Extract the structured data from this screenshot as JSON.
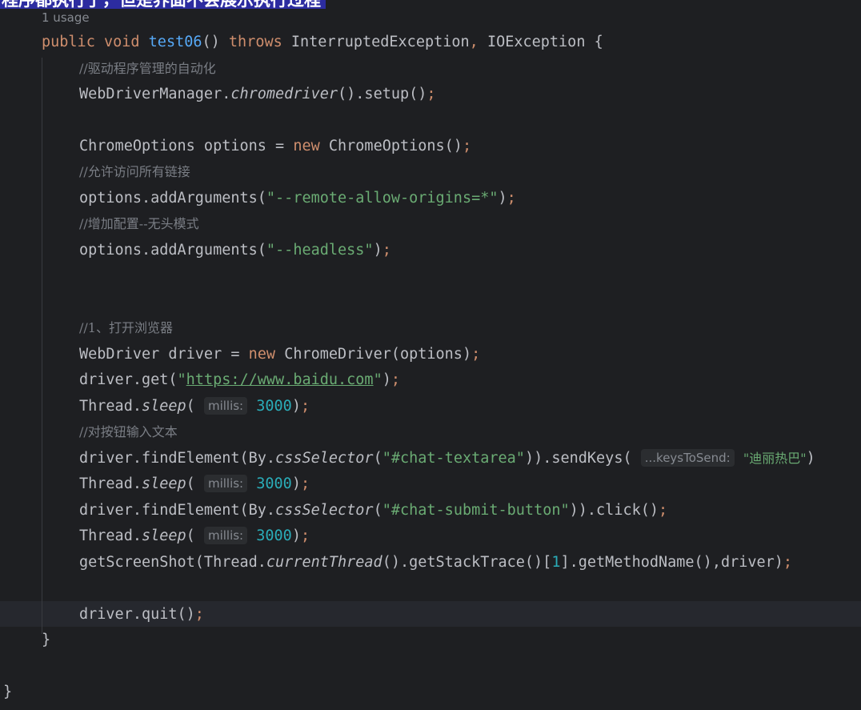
{
  "caption": "程序都执行了，但是界面不会展示执行过程",
  "usage_hint": "1 usage",
  "colors": {
    "background": "#1e1f22",
    "keyword": "#cf8e6d",
    "method": "#56a8f5",
    "string": "#6aab73",
    "number": "#2aacb8",
    "comment": "#7a7e85",
    "text": "#bcbec4"
  },
  "code": {
    "l1": {
      "public": "public",
      "void": "void",
      "name": "test06",
      "paren": "()",
      "throws": "throws",
      "ex1": "InterruptedException",
      "comma": ",",
      "ex2": "IOException {"
    },
    "l2": {
      "comment": "//驱动程序管理的自动化"
    },
    "l3": {
      "a": "WebDriverManager.",
      "b": "chromedriver",
      "c": "().setup()",
      "semi": ";"
    },
    "l4": {
      "a": "ChromeOptions options = ",
      "new": "new",
      "b": "ChromeOptions()",
      "semi": ";"
    },
    "l5": {
      "comment": "//允许访问所有链接"
    },
    "l6": {
      "a": "options.addArguments(",
      "s": "\"--remote-allow-origins=*\"",
      "b": ")",
      "semi": ";"
    },
    "l7": {
      "comment": "//增加配置--无头模式"
    },
    "l8": {
      "a": "options.addArguments(",
      "s": "\"--headless\"",
      "b": ")",
      "semi": ";"
    },
    "l9": {
      "comment": "//1、打开浏览器"
    },
    "l10": {
      "a": "WebDriver driver = ",
      "new": "new",
      "b": "ChromeDriver(options)",
      "semi": ";"
    },
    "l11": {
      "a": "driver.get(",
      "q1": "\"",
      "url": "https://www.baidu.com",
      "q2": "\"",
      "b": ")",
      "semi": ";"
    },
    "l12": {
      "a": "Thread.",
      "m": "sleep",
      "b": "( ",
      "hint": "millis:",
      "num": "3000",
      "c": ")",
      "semi": ";"
    },
    "l13": {
      "comment": "//对按钮输入文本"
    },
    "l14": {
      "a": "driver.findElement(By.",
      "m": "cssSelector",
      "b": "(",
      "s": "\"#chat-textarea\"",
      "c": ")).sendKeys( ",
      "hint": "...keysToSend:",
      "s2": "\"迪丽热巴\"",
      "d": ")"
    },
    "l15": {
      "a": "Thread.",
      "m": "sleep",
      "b": "( ",
      "hint": "millis:",
      "num": "3000",
      "c": ")",
      "semi": ";"
    },
    "l16": {
      "a": "driver.findElement(By.",
      "m": "cssSelector",
      "b": "(",
      "s": "\"#chat-submit-button\"",
      "c": ")).click()",
      "semi": ";"
    },
    "l17": {
      "a": "Thread.",
      "m": "sleep",
      "b": "( ",
      "hint": "millis:",
      "num": "3000",
      "c": ")",
      "semi": ";"
    },
    "l18": {
      "a": "getScreenShot(Thread.",
      "m": "currentThread",
      "b": "().getStackTrace()[",
      "num": "1",
      "c": "].getMethodName(),driver)",
      "semi": ";"
    },
    "l19": {
      "a": "driver.quit()",
      "semi": ";"
    },
    "l20": {
      "brace": "}"
    },
    "l21": {
      "brace": "}"
    }
  }
}
